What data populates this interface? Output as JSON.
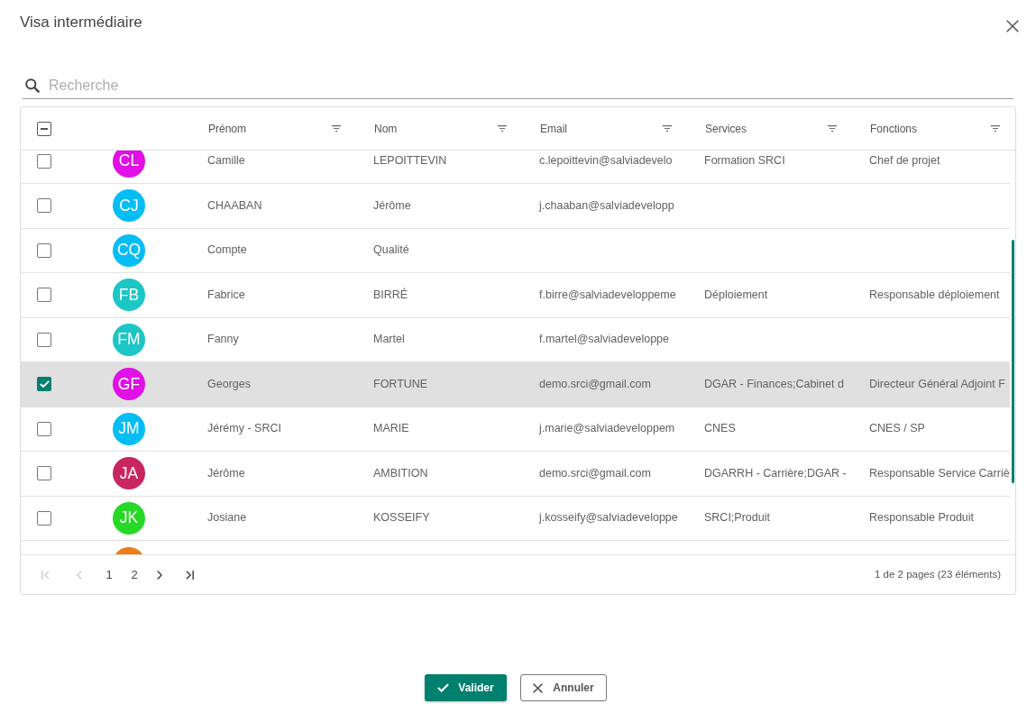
{
  "dialog": {
    "title": "Visa intermédiaire"
  },
  "search": {
    "placeholder": "Recherche"
  },
  "table": {
    "select_all": {
      "indeterminate": true
    },
    "columns": [
      {
        "label": "Prénom"
      },
      {
        "label": "Nom"
      },
      {
        "label": "Email"
      },
      {
        "label": "Services"
      },
      {
        "label": "Fonctions"
      }
    ],
    "rows": [
      {
        "kind": "full",
        "checked": false,
        "selected": false,
        "avatar": {
          "kind": "initials",
          "initials": "CL",
          "color": "#e010e6"
        },
        "prenom": "Camille",
        "nom": "LEPOITTEVIN",
        "email": "c.lepoittevin@salviadevelo",
        "services": "Formation SRCI",
        "fonctions": "Chef de projet"
      },
      {
        "kind": "full",
        "checked": false,
        "selected": false,
        "avatar": {
          "kind": "initials",
          "initials": "CJ",
          "color": "#05bdf5"
        },
        "prenom": "CHAABAN",
        "nom": "Jérôme",
        "email": "j.chaaban@salviadevelopp"
      },
      {
        "kind": "full",
        "checked": false,
        "selected": false,
        "avatar": {
          "kind": "initials",
          "initials": "CQ",
          "color": "#05bdf5"
        },
        "prenom": "Compte",
        "nom": "Qualité"
      },
      {
        "kind": "full",
        "checked": false,
        "selected": false,
        "avatar": {
          "kind": "initials",
          "initials": "FB",
          "color": "#1cc6c4"
        },
        "prenom": "Fabrice",
        "nom": "BIRRÉ",
        "email": "f.birre@salviadeveloppeme",
        "services": "Déploiement",
        "fonctions": "Responsable déploiement"
      },
      {
        "kind": "full",
        "checked": false,
        "selected": false,
        "avatar": {
          "kind": "initials",
          "initials": "FM",
          "color": "#1cc6c4"
        },
        "prenom": "Fanny",
        "nom": "Martel",
        "email": "f.martel@salviadeveloppe"
      },
      {
        "kind": "full",
        "checked": true,
        "selected": true,
        "avatar": {
          "kind": "initials",
          "initials": "GF",
          "color": "#e010e6"
        },
        "prenom": "Georges",
        "nom": "FORTUNE",
        "email": "demo.srci@gmail.com",
        "services": "DGAR - Finances;Cabinet d",
        "fonctions": "Directeur Général Adjoint F"
      },
      {
        "kind": "full",
        "checked": false,
        "selected": false,
        "avatar": {
          "kind": "initials",
          "initials": "JM",
          "color": "#05bdf5"
        },
        "prenom": "Jérémy - SRCI",
        "nom": "MARIE",
        "email": "j.marie@salviadeveloppem",
        "services": "CNES",
        "fonctions": "CNES / SP"
      },
      {
        "kind": "full",
        "checked": false,
        "selected": false,
        "avatar": {
          "kind": "initials",
          "initials": "JA",
          "color": "#c92560"
        },
        "prenom": "Jérôme",
        "nom": "AMBITION",
        "email": "demo.srci@gmail.com",
        "services": "DGARRH - Carrière;DGAR -",
        "fonctions": "Responsable Service Carriè"
      },
      {
        "kind": "full",
        "checked": false,
        "selected": false,
        "avatar": {
          "kind": "initials",
          "initials": "JK",
          "color": "#27d827"
        },
        "prenom": "Josiane",
        "nom": "KOSSEIFY",
        "email": "j.kosseify@salviadeveloppe",
        "services": "SRCI;Produit",
        "fonctions": "Responsable Produit"
      },
      {
        "kind": "cut_off",
        "avatar": {
          "kind": "photo",
          "color": "#ee7d15"
        }
      }
    ],
    "pagination": {
      "controls": [
        {
          "kind": "first",
          "disabled": true
        },
        {
          "kind": "prev",
          "disabled": true
        },
        {
          "kind": "page",
          "label": "1",
          "disabled": false
        },
        {
          "kind": "page",
          "label": "2",
          "disabled": false
        },
        {
          "kind": "next",
          "disabled": false
        },
        {
          "kind": "last",
          "disabled": false
        }
      ],
      "summary": "1 de 2 pages (23 éléments)"
    }
  },
  "buttons": [
    {
      "kind": "confirm",
      "label": "Valider"
    },
    {
      "kind": "cancel",
      "label": "Annuler"
    }
  ]
}
